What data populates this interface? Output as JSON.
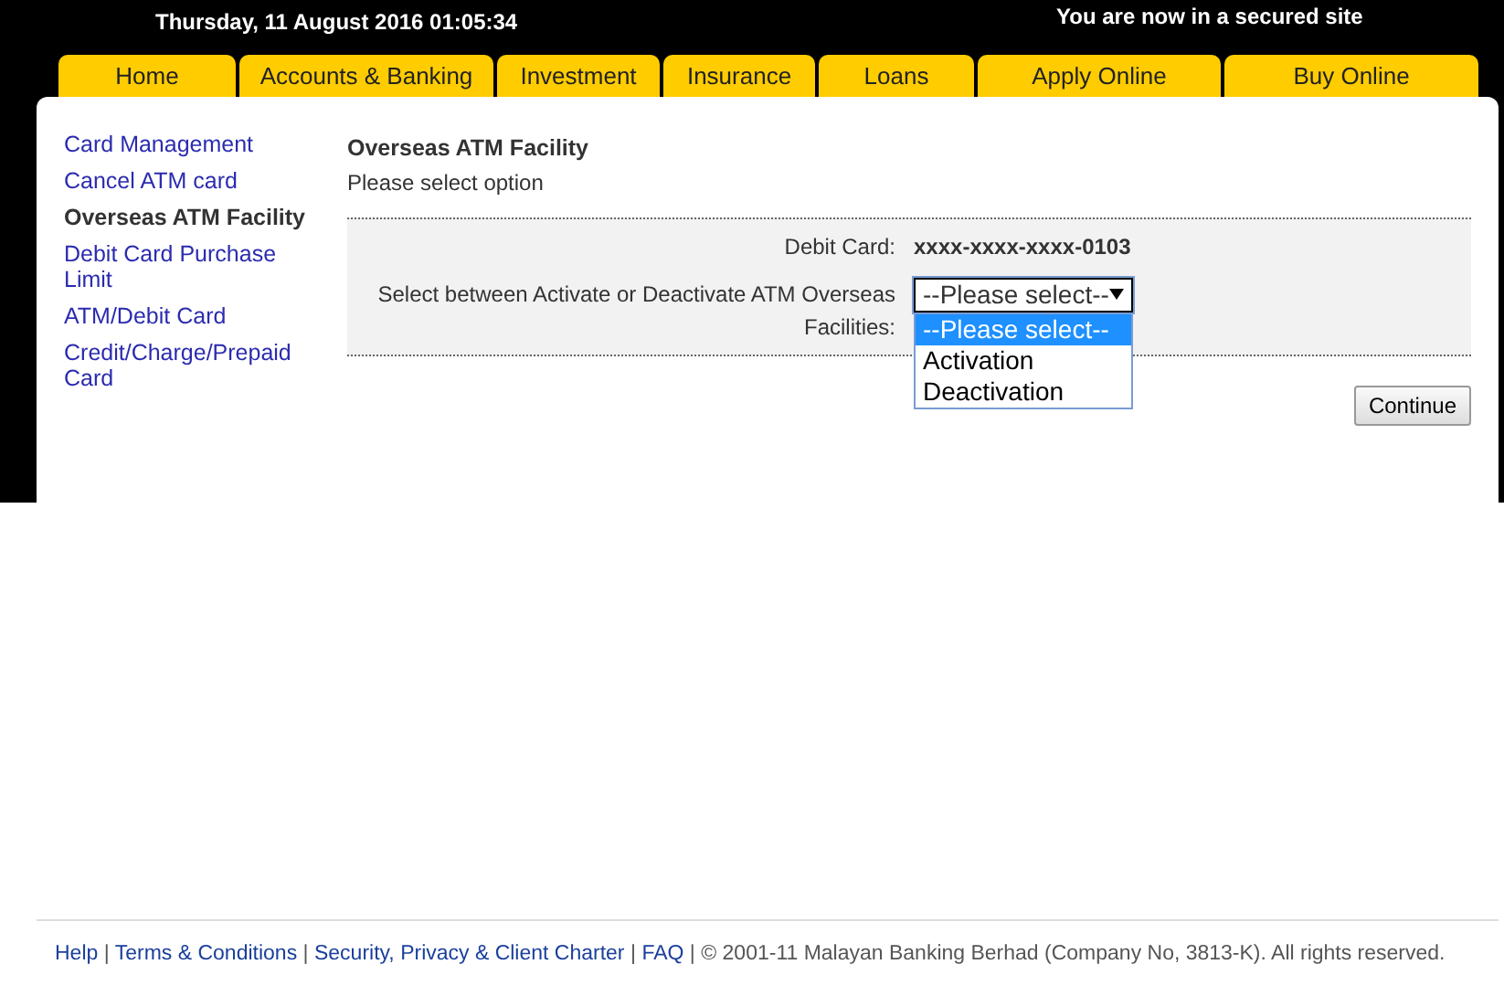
{
  "header": {
    "datetime": "Thursday, 11 August 2016 01:05:34",
    "secure_notice": "You are now in a secured site"
  },
  "nav_tabs": [
    "Home",
    "Accounts & Banking",
    "Investment",
    "Insurance",
    "Loans",
    "Apply Online",
    "Buy Online"
  ],
  "sidebar": {
    "items": [
      {
        "label": "Card Management",
        "selected": false
      },
      {
        "label": "Cancel ATM card",
        "selected": false
      },
      {
        "label": "Overseas ATM Facility",
        "selected": true
      },
      {
        "label": "Debit Card Purchase Limit",
        "selected": false
      },
      {
        "label": "ATM/Debit Card",
        "selected": false
      },
      {
        "label": "Credit/Charge/Prepaid Card",
        "selected": false
      }
    ]
  },
  "content": {
    "title": "Overseas ATM Facility",
    "subtitle": "Please select option",
    "form": {
      "debit_card_label": "Debit Card:",
      "debit_card_value": "xxxx-xxxx-xxxx-0103",
      "select_label": "Select between Activate or Deactivate ATM Overseas Facilities:",
      "select_value": "--Please select--",
      "expanded": true,
      "options": [
        {
          "label": "--Please select--",
          "selected": true
        },
        {
          "label": "Activation",
          "selected": false
        },
        {
          "label": "Deactivation",
          "selected": false
        }
      ]
    },
    "continue_button": "Continue"
  },
  "footer": [
    {
      "kind": "link",
      "text": "Help"
    },
    {
      "kind": "sep",
      "text": "|"
    },
    {
      "kind": "link",
      "text": "Terms & Conditions"
    },
    {
      "kind": "sep",
      "text": "|"
    },
    {
      "kind": "link",
      "text": "Security, Privacy & Client Charter"
    },
    {
      "kind": "sep",
      "text": "|"
    },
    {
      "kind": "link",
      "text": "FAQ"
    },
    {
      "kind": "sep",
      "text": "|"
    },
    {
      "kind": "text",
      "text": "© 2001-11 Malayan Banking Berhad (Company No, 3813-K). All rights reserved."
    }
  ]
}
